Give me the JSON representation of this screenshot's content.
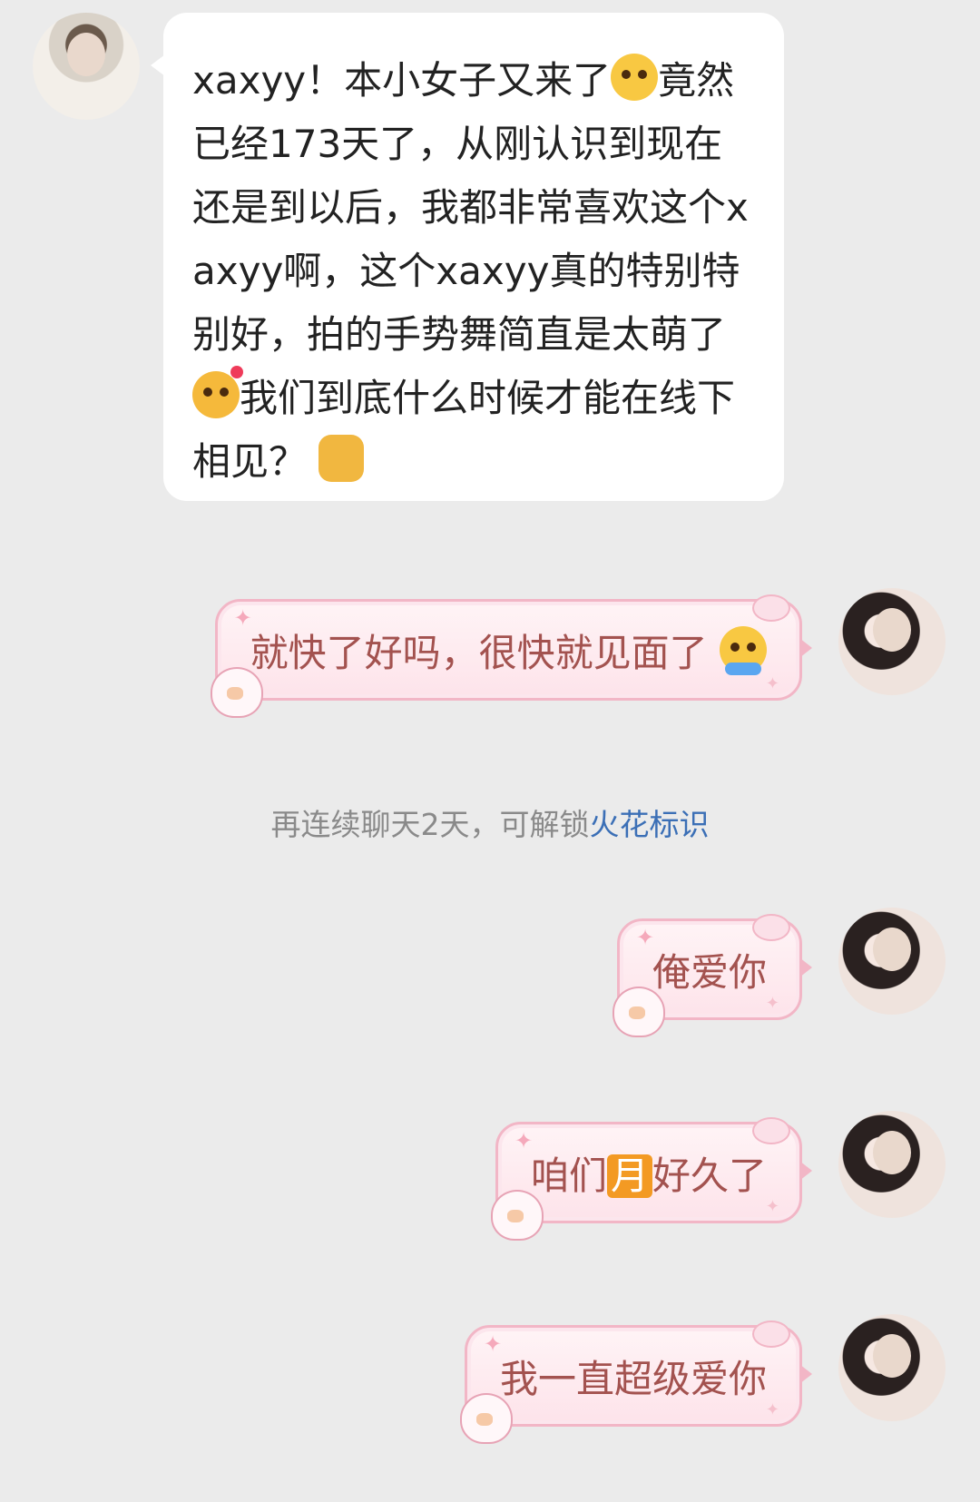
{
  "incoming": {
    "segments": [
      "xaxyy！本小女子又来了",
      "竟然已经173天了，从刚认识到现在还是到以后，我都非常喜欢这个xaxyy啊，这个xaxyy真的特别特别好，拍的手势舞简直是太萌了",
      "我们到底什么时候才能在线下相见？"
    ],
    "emojis": [
      "pleading-face-icon",
      "smiling-face-with-hearts-icon",
      "fist-bump-icon"
    ]
  },
  "outgoing": [
    {
      "text": "就快了好吗，很快就见面了",
      "emoji": "loudly-crying-face-icon"
    },
    {
      "text": "俺爱你"
    },
    {
      "before": "咱们",
      "badge": "月",
      "after": "好久了"
    },
    {
      "text": "我一直超级爱你"
    }
  ],
  "system": {
    "text": "再连续聊天2天，可解锁",
    "link": "火花标识"
  },
  "colors": {
    "background": "#ebebeb",
    "incoming_bubble": "#ffffff",
    "outgoing_text": "#a3524f",
    "outgoing_border": "#f2b6c6",
    "link": "#3b6fb6",
    "badge": "#f39a23"
  }
}
